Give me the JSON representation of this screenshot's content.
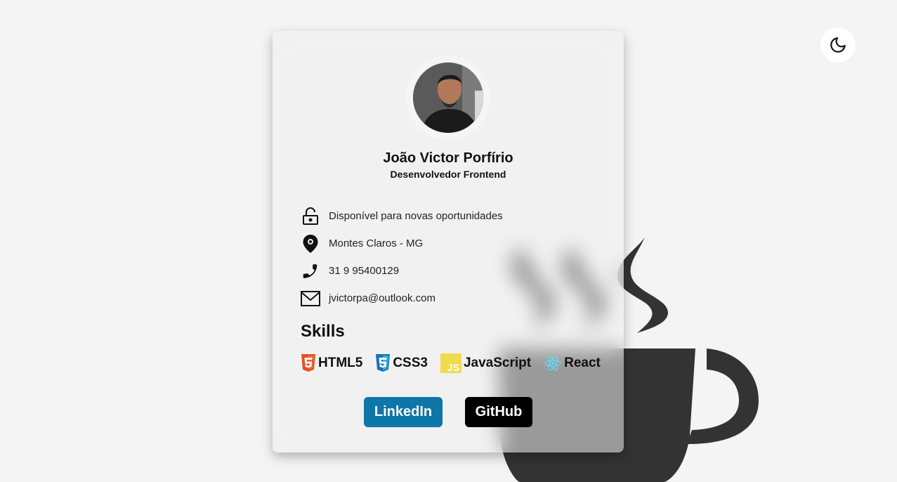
{
  "profile": {
    "name": "João Victor Porfírio",
    "role": "Desenvolvedor Frontend"
  },
  "info": {
    "availability": "Disponível para novas oportunidades",
    "location": "Montes Claros - MG",
    "phone": "31 9 95400129",
    "email": "jvictorpa@outlook.com"
  },
  "skills": {
    "title": "Skills",
    "items": [
      "HTML5",
      "CSS3",
      "JavaScript",
      "React"
    ]
  },
  "links": {
    "linkedin": "LinkedIn",
    "github": "GitHub"
  },
  "icons": {
    "theme": "moon-icon",
    "availability": "unlock-icon",
    "location": "map-pin-icon",
    "phone": "phone-icon",
    "email": "mail-icon",
    "html5": "html5-icon",
    "css3": "css3-icon",
    "javascript": "js-icon",
    "react": "react-icon",
    "background": "java-coffee-cup-icon"
  },
  "colors": {
    "background": "#f4f4f4",
    "card": "#eeeeee",
    "linkedin": "#0e76a8",
    "github": "#000000",
    "coffee_cup": "#333333",
    "html5": "#e34f26",
    "css3": "#1572b6",
    "javascript": "#f0db4f",
    "react": "#61dafb"
  }
}
